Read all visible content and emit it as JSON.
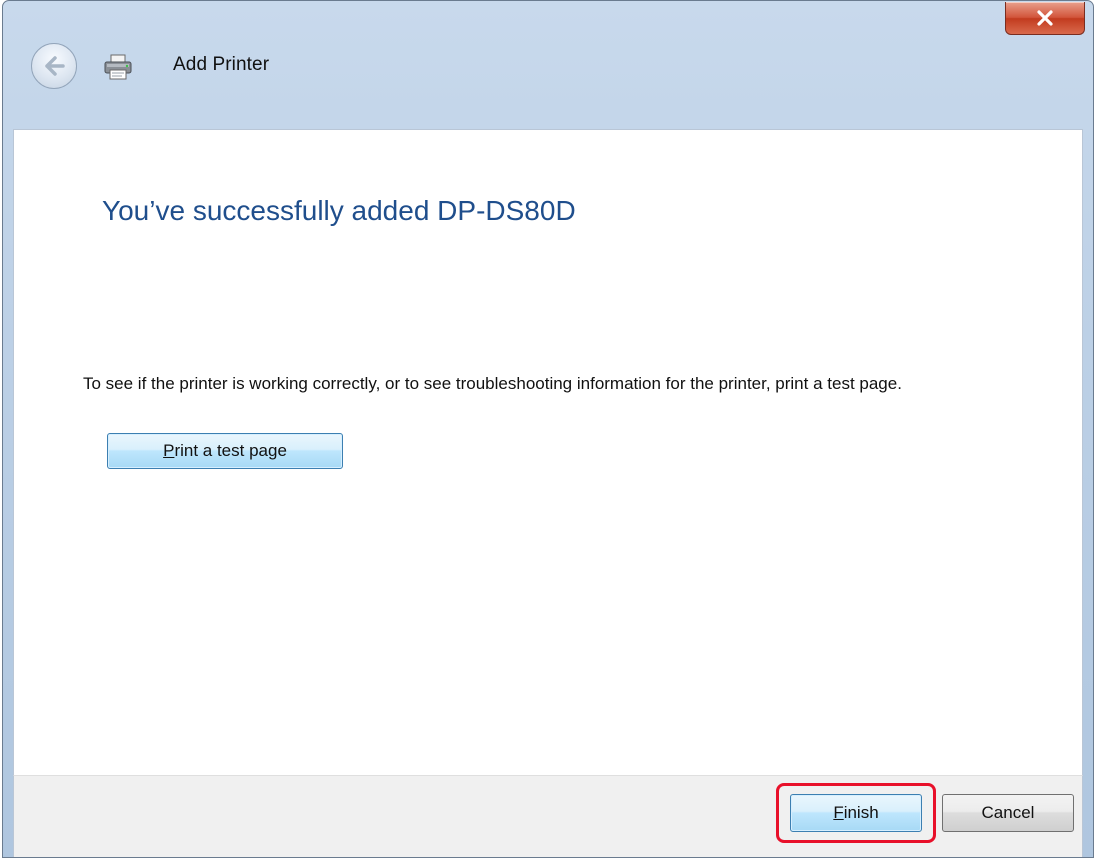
{
  "window": {
    "title": "Add Printer",
    "close_label": "X"
  },
  "content": {
    "heading": "You’ve successfully added DP-DS80D",
    "description": "To see if the printer is working correctly, or to see troubleshooting information for the printer, print a test page.",
    "test_button": {
      "access_key": "P",
      "rest": "rint a test page"
    }
  },
  "footer": {
    "finish_button": {
      "access_key": "F",
      "rest": "inish"
    },
    "cancel_button": "Cancel"
  },
  "colors": {
    "heading": "#1f4e8c",
    "close_button": "#c23b1f",
    "highlight": "#e8102a"
  },
  "icons": [
    "back-arrow-icon",
    "printer-icon",
    "close-icon"
  ]
}
